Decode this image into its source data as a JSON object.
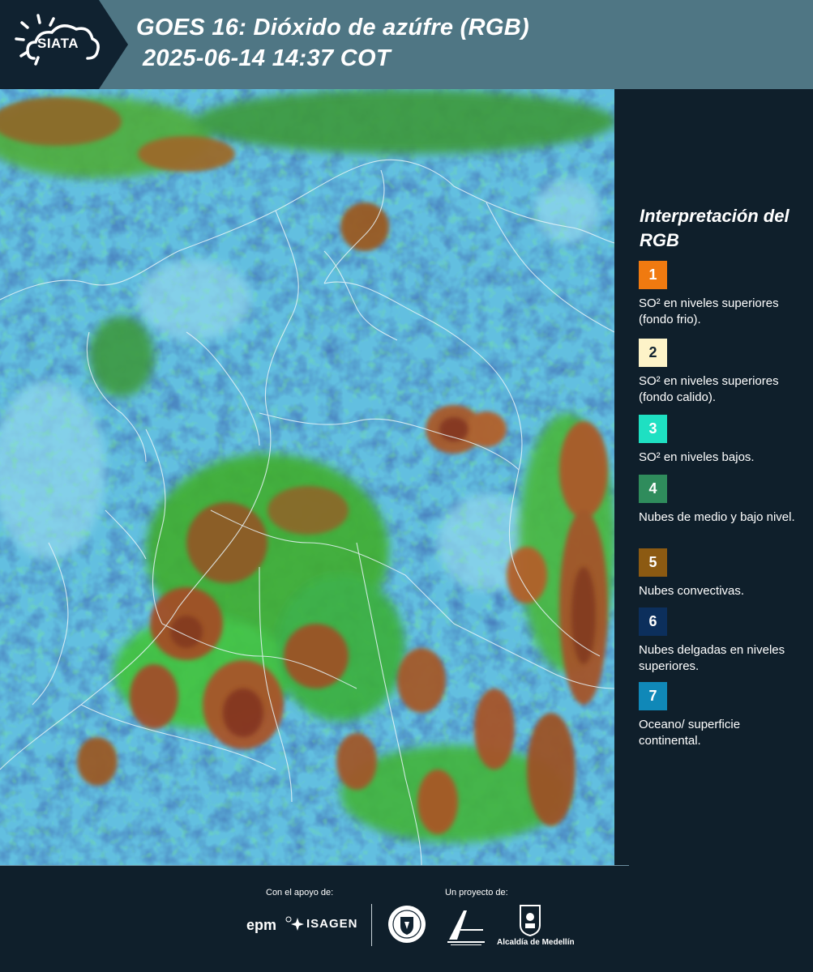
{
  "header": {
    "logo_text": "SIATA",
    "title": "GOES 16: Dióxido de azúfre (RGB)",
    "subtitle": "2025-06-14 14:37 COT"
  },
  "legend": {
    "title": "Interpretación del RGB",
    "items": [
      {
        "number": "1",
        "color": "#f07a10",
        "text": "SO² en niveles superiores (fondo frio)."
      },
      {
        "number": "2",
        "color": "#fdf3c8",
        "text": "SO² en niveles superiores (fondo calido)."
      },
      {
        "number": "3",
        "color": "#1ee0c2",
        "text": "SO² en niveles bajos."
      },
      {
        "number": "4",
        "color": "#2f8c5c",
        "text": "Nubes de medio y bajo nivel."
      },
      {
        "number": "5",
        "color": "#8c5a12",
        "text": "Nubes convectivas."
      },
      {
        "number": "6",
        "color": "#0c2f5c",
        "text": "Nubes delgadas en niveles superiores."
      },
      {
        "number": "7",
        "color": "#1088b8",
        "text": "Oceano/ superficie continental."
      }
    ]
  },
  "footer": {
    "support_label": "Con el apoyo de:",
    "project_label": "Un proyecto de:",
    "sponsor_1": "epm",
    "sponsor_2": "ISAGEN",
    "partner_2": "Alcaldía de Medellín"
  },
  "map": {
    "icons": [
      "siata-logo",
      "epm-logo",
      "isagen-logo",
      "medellin-seal",
      "metropolitana-logo",
      "alcaldia-logo"
    ]
  }
}
